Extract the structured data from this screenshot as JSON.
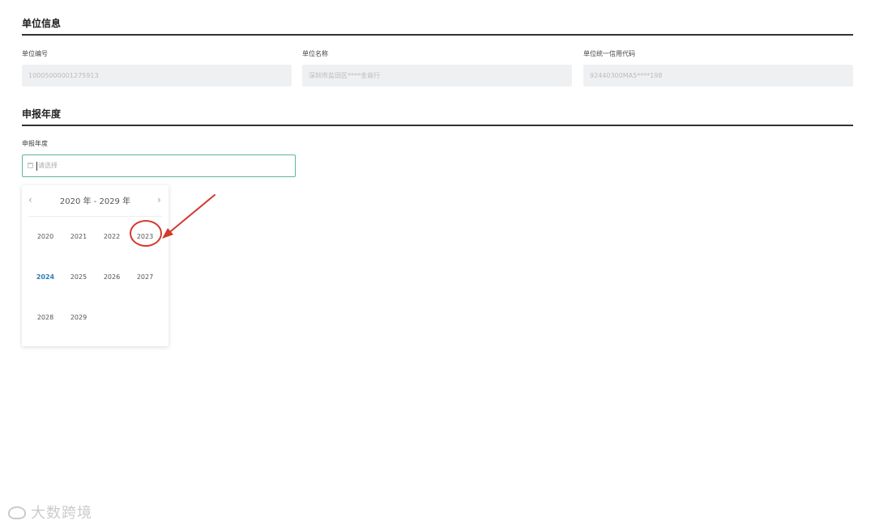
{
  "unit_info": {
    "title": "单位信息",
    "fields": [
      {
        "label": "单位编号",
        "value": "10005000001275913"
      },
      {
        "label": "单位名称",
        "value": "深圳市盐田区****金商行"
      },
      {
        "label": "单位统一信用代码",
        "value": "92440300MA5****198"
      }
    ]
  },
  "report_year": {
    "title": "申报年度",
    "label": "申报年度",
    "placeholder": "请选择",
    "picker": {
      "range_label": "2020 年 - 2029 年",
      "prev_icon": "‹",
      "next_icon": "›",
      "years": [
        "2020",
        "2021",
        "2022",
        "2023",
        "2024",
        "2025",
        "2026",
        "2027",
        "2028",
        "2029"
      ],
      "current_year": "2024",
      "annotated_year": "2023"
    }
  },
  "annotation": {
    "color": "#d3392c"
  },
  "watermark": {
    "text": "大数跨境"
  },
  "colors": {
    "input_focus_border": "#5fb59e",
    "current_year": "#2f7fb0",
    "disabled_bg": "#eff0f2"
  }
}
